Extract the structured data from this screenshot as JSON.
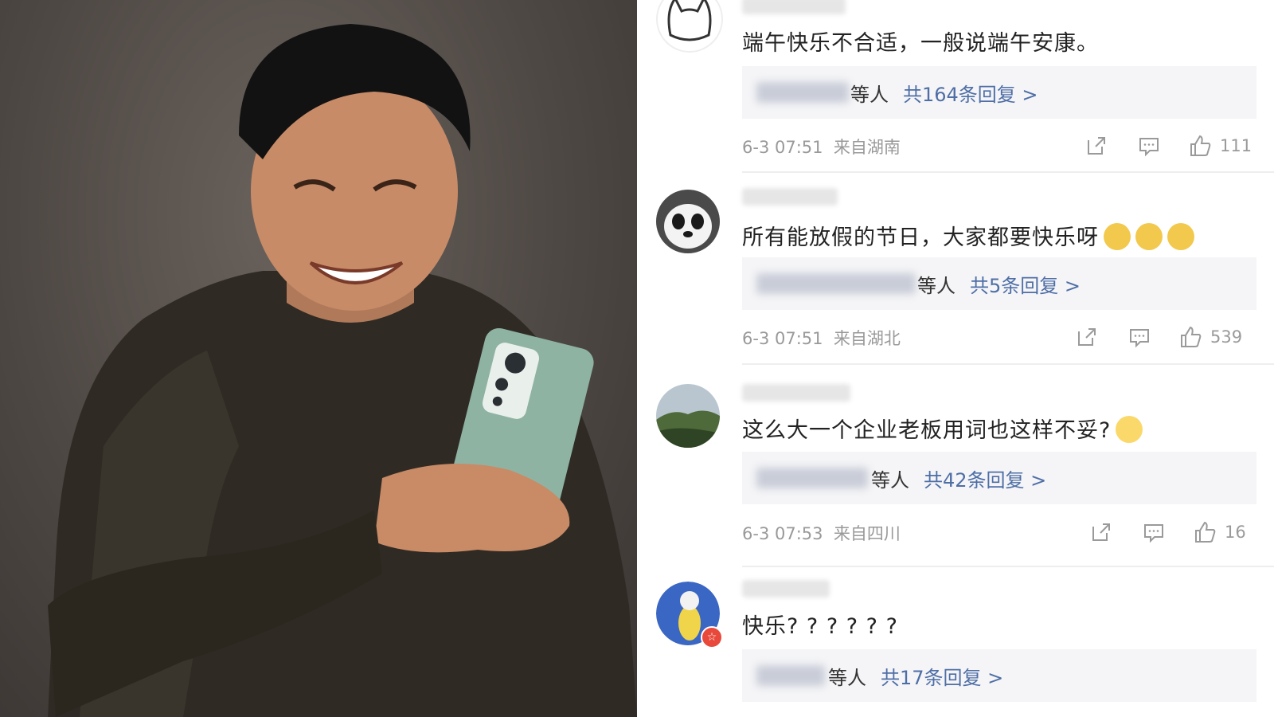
{
  "comments": [
    {
      "text": "端午快乐不合适，一般说端午安康。",
      "reply_by": "等人",
      "reply_link": "共164条回复 >",
      "time": "6-3 07:51",
      "location": "来自湖南",
      "likes": "111",
      "avatar": "cat-outline-avatar"
    },
    {
      "text": "所有能放假的节日，大家都要快乐呀",
      "emojis": [
        "doge-icon",
        "doge-icon",
        "doge-icon"
      ],
      "reply_by": "等人",
      "reply_link": "共5条回复 >",
      "time": "6-3 07:51",
      "location": "来自湖北",
      "likes": "539",
      "avatar": "panda-avatar"
    },
    {
      "text": "这么大一个企业老板用词也这样不妥?",
      "emojis": [
        "laugh-cry-icon"
      ],
      "reply_by": "等人",
      "reply_link": "共42条回复 >",
      "time": "6-3 07:53",
      "location": "来自四川",
      "likes": "16",
      "avatar": "landscape-avatar"
    },
    {
      "text": "快乐? ? ? ? ? ?",
      "reply_by": "等人",
      "reply_link": "共17条回复 >",
      "avatar": "dog-avatar"
    }
  ],
  "colors": {
    "reply_link": "#4e6ea6",
    "meta_gray": "#999999",
    "reply_bg": "#f5f5f7"
  }
}
